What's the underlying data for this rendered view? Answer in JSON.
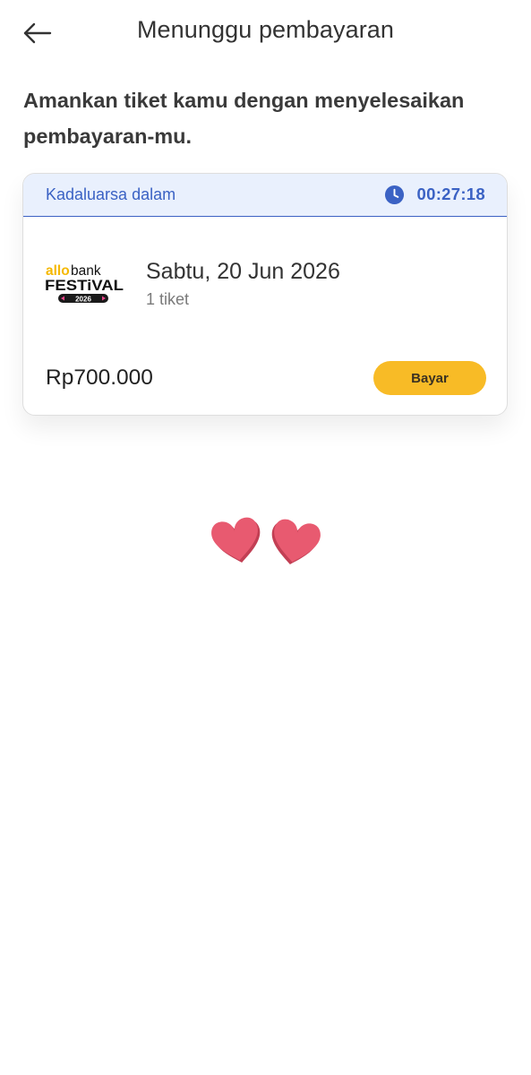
{
  "header": {
    "title": "Menunggu pembayaran",
    "back_icon": "arrow-left-icon"
  },
  "intro_text": "Amankan tiket kamu dengan menyelesaikan pembayaran-mu.",
  "order_card": {
    "expiry_label": "Kadaluarsa dalam",
    "timer": "00:27:18",
    "clock_icon": "clock-icon",
    "event": {
      "logo_brand_left": "allo",
      "logo_brand_right": "bank",
      "logo_name": "FESTiVAL",
      "logo_year": "2026",
      "date": "Sabtu, 20 Jun 2026",
      "tickets": "1 tiket"
    },
    "price": "Rp700.000",
    "pay_label": "Bayar"
  },
  "decoration": {
    "icon": "two-hearts-icon"
  },
  "colors": {
    "accent_blue": "#3b62c4",
    "expiry_background": "#e9f0fd",
    "pay_button": "#f8bb26",
    "heart": "#e85a70",
    "logo_yellow": "#f5b800"
  }
}
